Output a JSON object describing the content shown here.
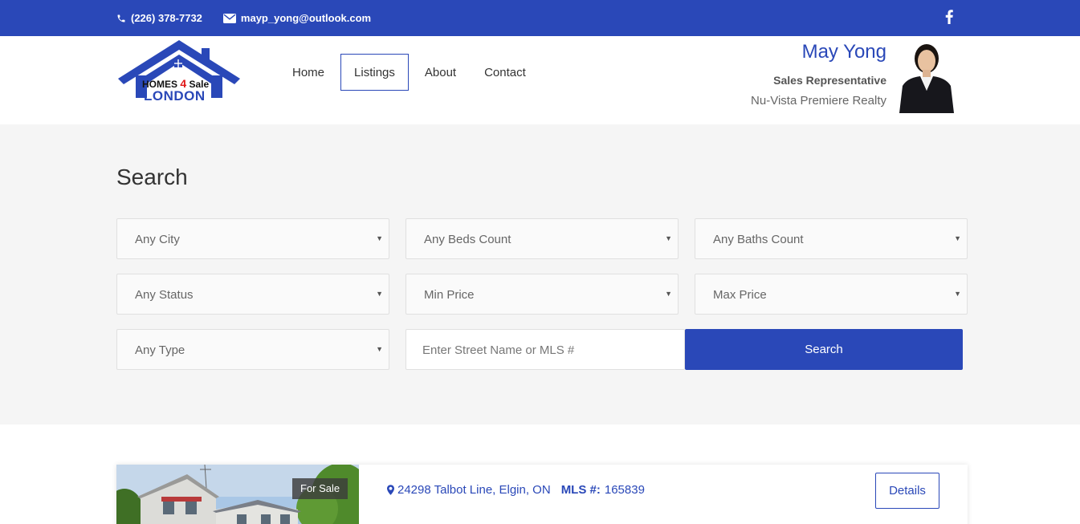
{
  "topbar": {
    "phone": "(226) 378-7732",
    "email": "mayp_yong@outlook.com",
    "social_icon": "facebook-icon"
  },
  "brand": {
    "logo_line1_a": "HOMES",
    "logo_line1_b": "4",
    "logo_line1_c": "Sale",
    "logo_line2": "LONDON"
  },
  "nav": {
    "items": [
      {
        "label": "Home",
        "active": false
      },
      {
        "label": "Listings",
        "active": true
      },
      {
        "label": "About",
        "active": false
      },
      {
        "label": "Contact",
        "active": false
      }
    ]
  },
  "agent": {
    "name": "May Yong",
    "role": "Sales Representative",
    "company": "Nu-Vista Premiere Realty"
  },
  "search": {
    "title": "Search",
    "city": "Any City",
    "beds": "Any Beds Count",
    "baths": "Any Baths Count",
    "status": "Any Status",
    "min_price": "Min Price",
    "max_price": "Max Price",
    "type": "Any Type",
    "street_placeholder": "Enter Street Name or MLS #",
    "button": "Search"
  },
  "listing": {
    "badge": "For Sale",
    "address": "24298 Talbot Line, Elgin, ON",
    "mls_label": "MLS #:",
    "mls_number": "165839",
    "details_button": "Details"
  },
  "colors": {
    "brand_blue": "#2a48b8",
    "logo_red": "#e01818"
  }
}
